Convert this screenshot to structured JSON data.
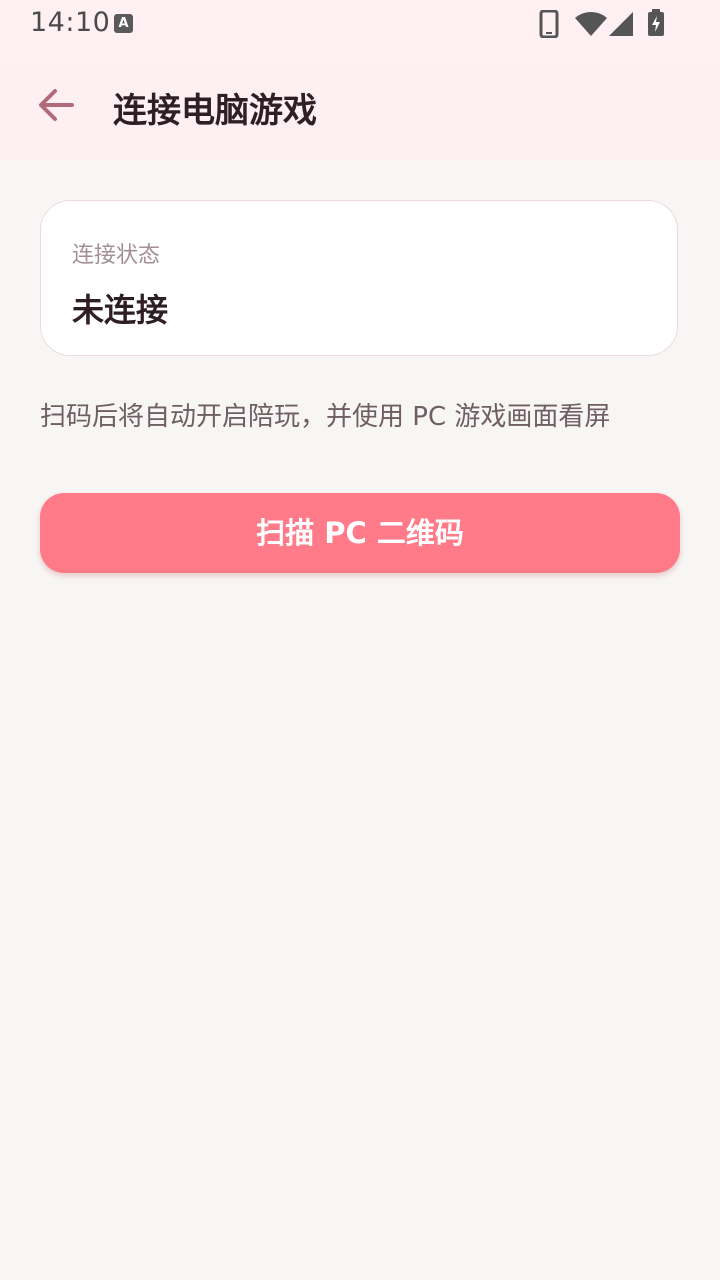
{
  "status_bar": {
    "time": "14:10",
    "notification_icon": "a-icon",
    "icons": [
      "phone-icon",
      "wifi-icon",
      "signal-icon",
      "battery-charging-icon"
    ]
  },
  "app_bar": {
    "back_icon": "back-arrow-icon",
    "title": "连接电脑游戏"
  },
  "connection_card": {
    "label": "连接状态",
    "value": "未连接"
  },
  "hint": "扫码后将自动开启陪玩，并使用 PC 游戏画面看屏",
  "scan_button": {
    "label": "扫描 PC 二维码"
  },
  "colors": {
    "accent": "#ff7b89",
    "back_arrow": "#b06b7a",
    "title": "#2e1f24",
    "background": "#f8f6f4",
    "header_background": "#fff1f3"
  }
}
